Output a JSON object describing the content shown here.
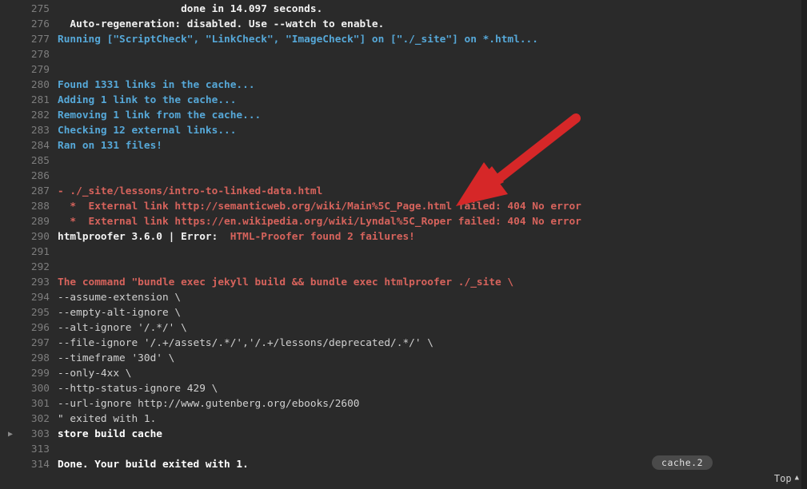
{
  "lines": [
    {
      "num": "275",
      "spans": [
        {
          "cls": "c-white",
          "pre": "                    ",
          "text": "done in 14.097 seconds."
        }
      ]
    },
    {
      "num": "276",
      "spans": [
        {
          "cls": "c-white",
          "pre": "  ",
          "text": "Auto-regeneration: disabled. Use --watch to enable."
        }
      ]
    },
    {
      "num": "277",
      "spans": [
        {
          "cls": "c-blue",
          "pre": "",
          "text": "Running [\"ScriptCheck\", \"LinkCheck\", \"ImageCheck\"] on [\"./_site\"] on *.html..."
        }
      ]
    },
    {
      "num": "278",
      "spans": []
    },
    {
      "num": "279",
      "spans": []
    },
    {
      "num": "280",
      "spans": [
        {
          "cls": "c-blue",
          "pre": "",
          "text": "Found 1331 links in the cache..."
        }
      ]
    },
    {
      "num": "281",
      "spans": [
        {
          "cls": "c-blue",
          "pre": "",
          "text": "Adding 1 link to the cache..."
        }
      ]
    },
    {
      "num": "282",
      "spans": [
        {
          "cls": "c-blue",
          "pre": "",
          "text": "Removing 1 link from the cache..."
        }
      ]
    },
    {
      "num": "283",
      "spans": [
        {
          "cls": "c-blue",
          "pre": "",
          "text": "Checking 12 external links..."
        }
      ]
    },
    {
      "num": "284",
      "spans": [
        {
          "cls": "c-blue",
          "pre": "",
          "text": "Ran on 131 files!"
        }
      ]
    },
    {
      "num": "285",
      "spans": []
    },
    {
      "num": "286",
      "spans": []
    },
    {
      "num": "287",
      "spans": [
        {
          "cls": "c-red",
          "pre": "",
          "text": "- ./_site/lessons/intro-to-linked-data.html"
        }
      ]
    },
    {
      "num": "288",
      "spans": [
        {
          "cls": "c-red",
          "pre": "  ",
          "text": "*  External link http://semanticweb.org/wiki/Main%5C_Page.html failed: 404 No error"
        }
      ]
    },
    {
      "num": "289",
      "spans": [
        {
          "cls": "c-red",
          "pre": "  ",
          "text": "*  External link https://en.wikipedia.org/wiki/Lyndal%5C_Roper failed: 404 No error"
        }
      ]
    },
    {
      "num": "290",
      "spans": [
        {
          "cls": "c-white",
          "pre": "",
          "text": "htmlproofer 3.6.0 | Error:  "
        },
        {
          "cls": "c-red",
          "pre": "",
          "text": "HTML-Proofer found 2 failures!"
        }
      ]
    },
    {
      "num": "291",
      "spans": []
    },
    {
      "num": "292",
      "spans": []
    },
    {
      "num": "293",
      "spans": [
        {
          "cls": "c-red",
          "pre": "",
          "text": "The command \"bundle exec jekyll build && bundle exec htmlproofer ./_site \\"
        }
      ]
    },
    {
      "num": "294",
      "spans": [
        {
          "cls": "c-gray",
          "pre": "",
          "text": "--assume-extension \\"
        }
      ]
    },
    {
      "num": "295",
      "spans": [
        {
          "cls": "c-gray",
          "pre": "",
          "text": "--empty-alt-ignore \\"
        }
      ]
    },
    {
      "num": "296",
      "spans": [
        {
          "cls": "c-gray",
          "pre": "",
          "text": "--alt-ignore '/.*/' \\"
        }
      ]
    },
    {
      "num": "297",
      "spans": [
        {
          "cls": "c-gray",
          "pre": "",
          "text": "--file-ignore '/.+/assets/.*/','/.+/lessons/deprecated/.*/' \\"
        }
      ]
    },
    {
      "num": "298",
      "spans": [
        {
          "cls": "c-gray",
          "pre": "",
          "text": "--timeframe '30d' \\"
        }
      ]
    },
    {
      "num": "299",
      "spans": [
        {
          "cls": "c-gray",
          "pre": "",
          "text": "--only-4xx \\"
        }
      ]
    },
    {
      "num": "300",
      "spans": [
        {
          "cls": "c-gray",
          "pre": "",
          "text": "--http-status-ignore 429 \\"
        }
      ]
    },
    {
      "num": "301",
      "spans": [
        {
          "cls": "c-gray",
          "pre": "",
          "text": "--url-ignore http://www.gutenberg.org/ebooks/2600"
        }
      ]
    },
    {
      "num": "302",
      "spans": [
        {
          "cls": "c-gray",
          "pre": "",
          "text": "\" exited with 1."
        }
      ]
    },
    {
      "num": "303",
      "spans": [
        {
          "cls": "bold-line",
          "pre": "",
          "text": "store build cache"
        }
      ],
      "caret": true
    },
    {
      "num": "313",
      "spans": []
    },
    {
      "num": "314",
      "spans": [
        {
          "cls": "bold-line",
          "pre": "",
          "text": "Done. Your build exited with 1."
        }
      ]
    }
  ],
  "badge": {
    "text": "cache.2"
  },
  "top_button": {
    "label": "Top"
  },
  "arrow_color": "#d62728"
}
